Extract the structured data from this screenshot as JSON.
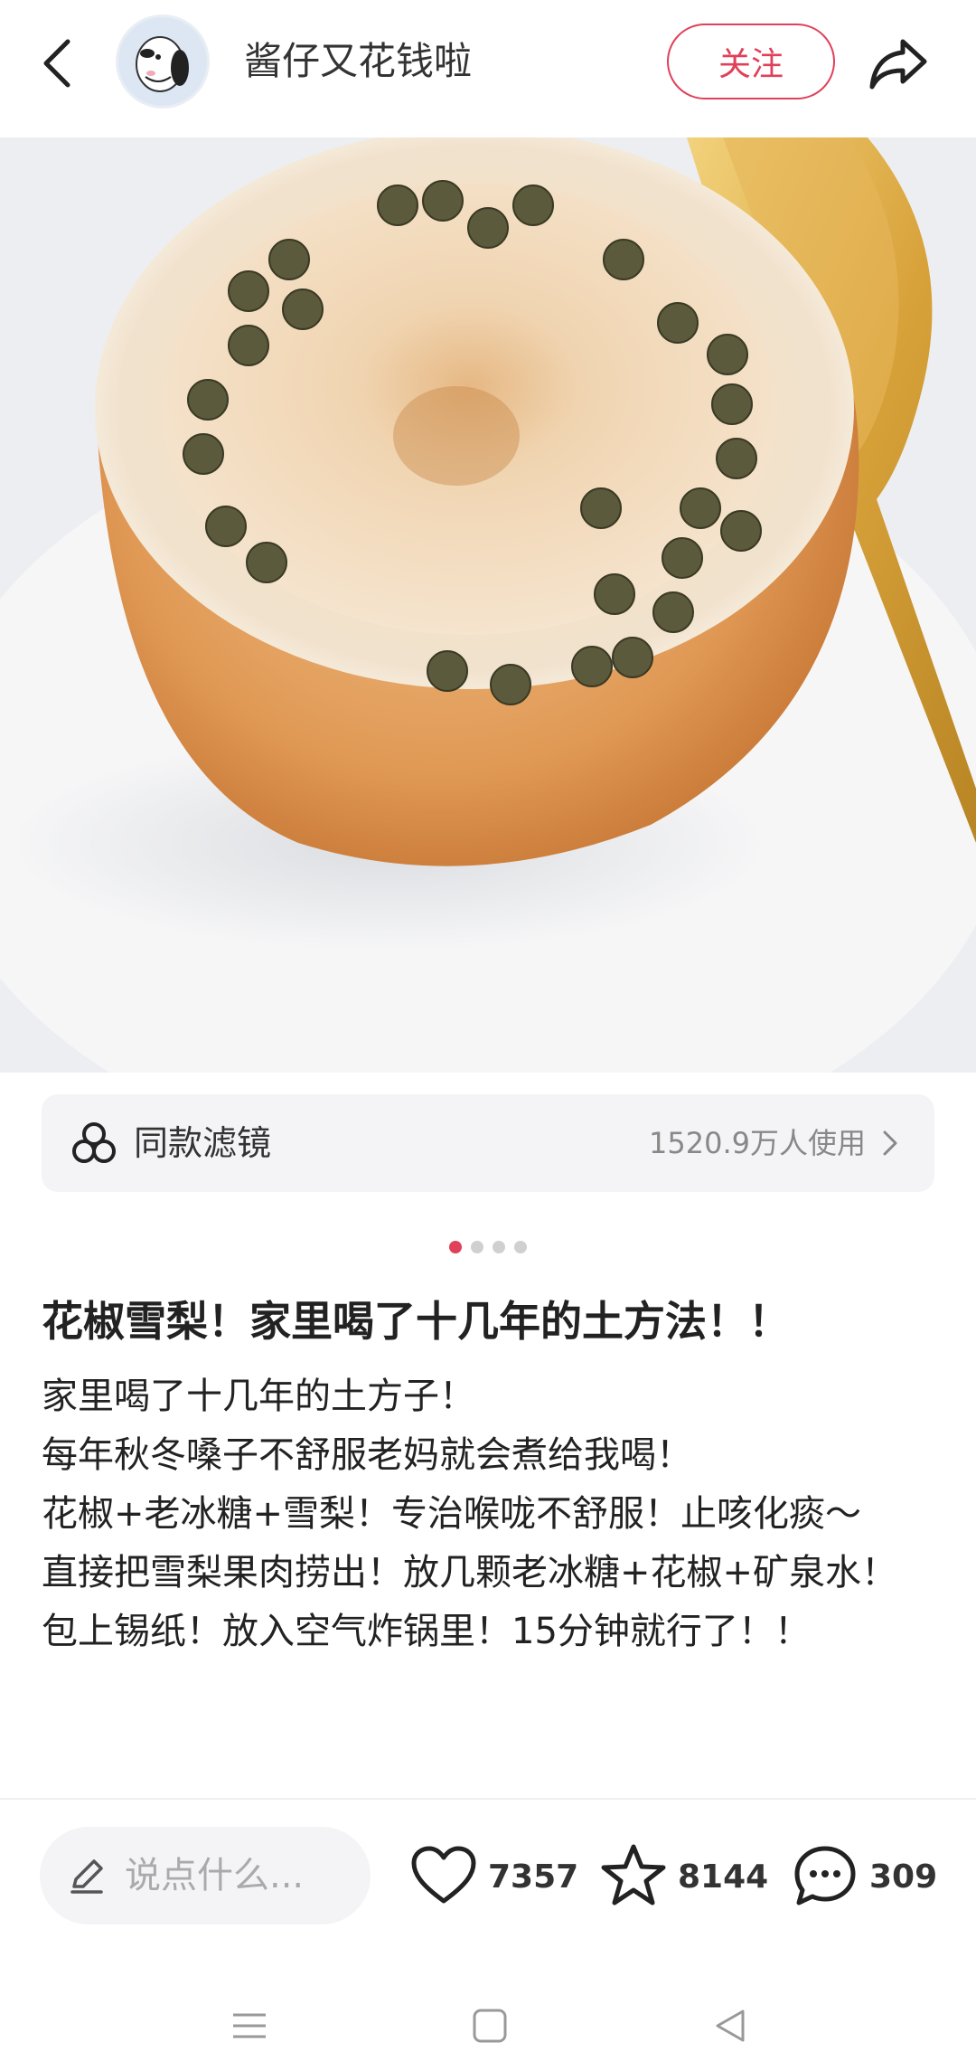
{
  "header": {
    "author_name": "酱仔又花钱啦",
    "follow_label": "关注"
  },
  "photo": {
    "description_icon": "food-photo"
  },
  "filter": {
    "label": "同款滤镜",
    "usage": "1520.9万人使用"
  },
  "pager": {
    "total": 4,
    "active_index": 0
  },
  "post": {
    "title": "花椒雪梨！家里喝了十几年的土方法！！",
    "body_lines": [
      "家里喝了十几年的土方子！",
      "每年秋冬嗓子不舒服老妈就会煮给我喝！",
      "花椒+老冰糖+雪梨！专治喉咙不舒服！止咳化痰～",
      "直接把雪梨果肉捞出！放几颗老冰糖+花椒+矿泉水！",
      "包上锡纸！放入空气炸锅里！15分钟就行了！！"
    ]
  },
  "bottom_bar": {
    "comment_placeholder": "说点什么...",
    "likes": "7357",
    "collects": "8144",
    "comments": "309"
  },
  "colors": {
    "accent": "#e0405a",
    "text": "#222222",
    "muted": "#888888"
  }
}
